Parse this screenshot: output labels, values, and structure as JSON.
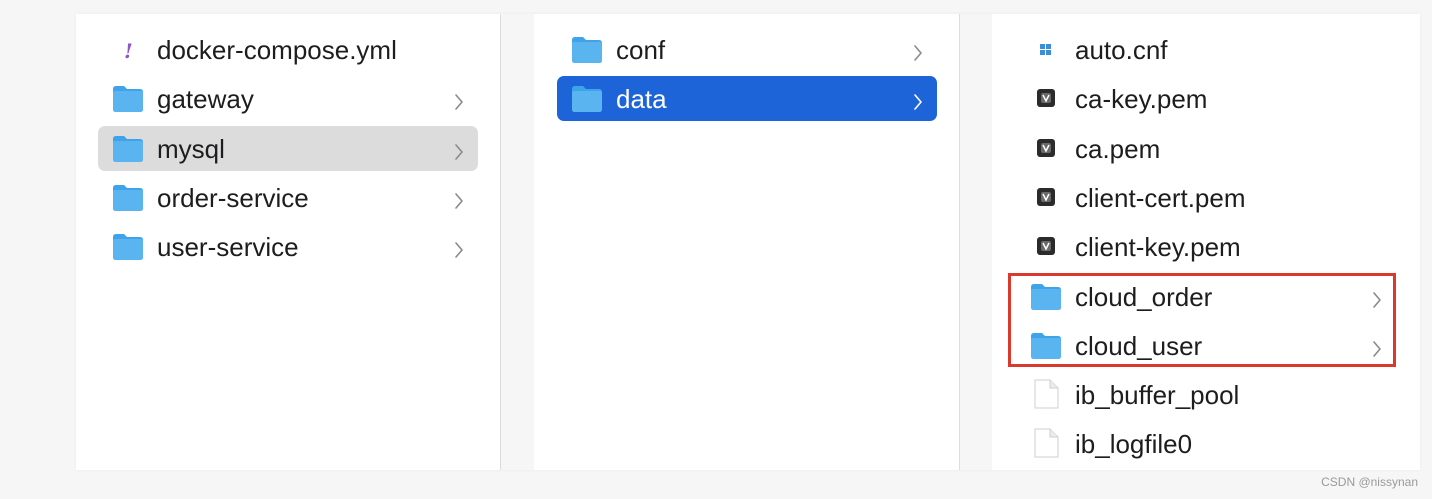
{
  "columns": [
    {
      "items": [
        {
          "label": "docker-compose.yml",
          "icon": "yaml-file-icon",
          "folder": false,
          "selected": "none"
        },
        {
          "label": "gateway",
          "icon": "folder-icon",
          "folder": true,
          "selected": "none"
        },
        {
          "label": "mysql",
          "icon": "folder-icon",
          "folder": true,
          "selected": "inactive"
        },
        {
          "label": "order-service",
          "icon": "folder-icon",
          "folder": true,
          "selected": "none"
        },
        {
          "label": "user-service",
          "icon": "folder-icon",
          "folder": true,
          "selected": "none"
        }
      ]
    },
    {
      "items": [
        {
          "label": "conf",
          "icon": "folder-icon",
          "folder": true,
          "selected": "none"
        },
        {
          "label": "data",
          "icon": "folder-icon",
          "folder": true,
          "selected": "active"
        }
      ]
    },
    {
      "items": [
        {
          "label": "auto.cnf",
          "icon": "cnf-file-icon",
          "folder": false,
          "selected": "none"
        },
        {
          "label": "ca-key.pem",
          "icon": "certificate-file-icon",
          "folder": false,
          "selected": "none"
        },
        {
          "label": "ca.pem",
          "icon": "certificate-file-icon",
          "folder": false,
          "selected": "none"
        },
        {
          "label": "client-cert.pem",
          "icon": "certificate-file-icon",
          "folder": false,
          "selected": "none"
        },
        {
          "label": "client-key.pem",
          "icon": "certificate-file-icon",
          "folder": false,
          "selected": "none"
        },
        {
          "label": "cloud_order",
          "icon": "folder-icon",
          "folder": true,
          "selected": "none"
        },
        {
          "label": "cloud_user",
          "icon": "folder-icon",
          "folder": true,
          "selected": "none"
        },
        {
          "label": "ib_buffer_pool",
          "icon": "blank-file-icon",
          "folder": false,
          "selected": "none"
        },
        {
          "label": "ib_logfile0",
          "icon": "blank-file-icon",
          "folder": false,
          "selected": "none"
        }
      ]
    }
  ],
  "highlight": {
    "color": "#d93a2b",
    "items": [
      "cloud_order",
      "cloud_user"
    ]
  },
  "colors": {
    "selection_active": "#1e64d9",
    "selection_inactive": "#dcdcdc",
    "folder": "#5ab4f0"
  },
  "watermark": "CSDN @nissynan"
}
